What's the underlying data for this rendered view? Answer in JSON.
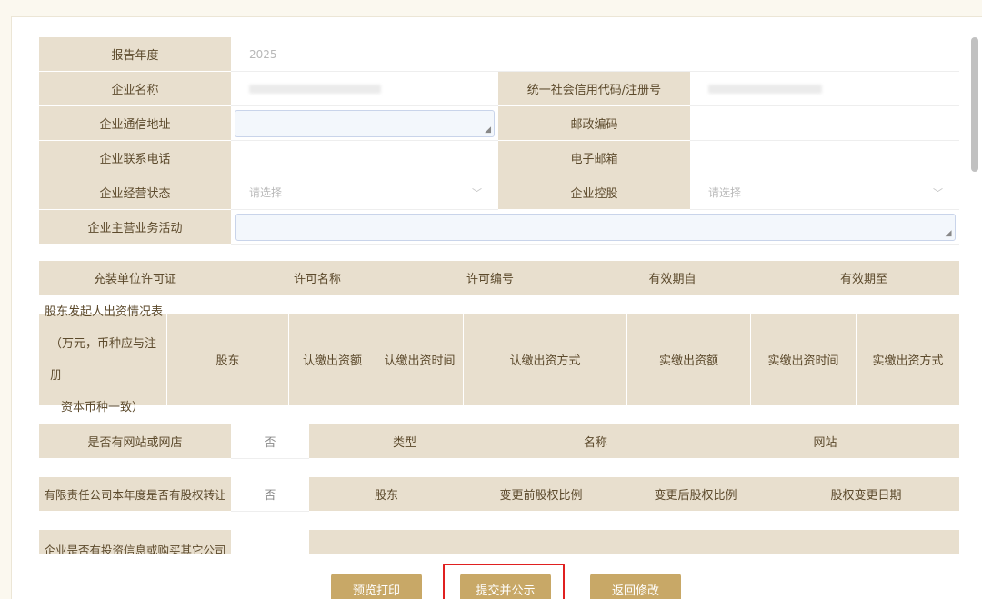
{
  "basic": {
    "report_year_label": "报告年度",
    "report_year_value": "2025",
    "company_name_label": "企业名称",
    "credit_code_label": "统一社会信用代码/注册号",
    "address_label": "企业通信地址",
    "postal_code_label": "邮政编码",
    "phone_label": "企业联系电话",
    "email_label": "电子邮箱",
    "status_label": "企业经营状态",
    "status_placeholder": "请选择",
    "holding_label": "企业控股",
    "holding_placeholder": "请选择",
    "business_label": "企业主营业务活动"
  },
  "license_table": {
    "headers": [
      "充装单位许可证",
      "许可名称",
      "许可编号",
      "有效期自",
      "有效期至"
    ]
  },
  "shareholder_table": {
    "title_lines": [
      "股东发起人出资情况表",
      "（万元，币种应与注册",
      "资本币种一致）"
    ],
    "headers": [
      "股东",
      "认缴出资额",
      "认缴出资时间",
      "认缴出资方式",
      "实缴出资额",
      "实缴出资时间",
      "实缴出资方式"
    ]
  },
  "website_table": {
    "question": "是否有网站或网店",
    "answer": "否",
    "headers": [
      "类型",
      "名称",
      "网站"
    ]
  },
  "equity_table": {
    "question": "有限责任公司本年度是否有股权转让",
    "answer": "否",
    "headers": [
      "股东",
      "变更前股权比例",
      "变更后股权比例",
      "股权变更日期"
    ]
  },
  "investment_row": {
    "question": "企业是否有投资信息或购买其它公司"
  },
  "buttons": {
    "preview_print": "预览打印",
    "submit_publish": "提交并公示",
    "back_edit": "返回修改"
  },
  "colors": {
    "label_bg": "#e8dfce",
    "button_bg": "#c8a867",
    "highlight": "#e02020"
  }
}
